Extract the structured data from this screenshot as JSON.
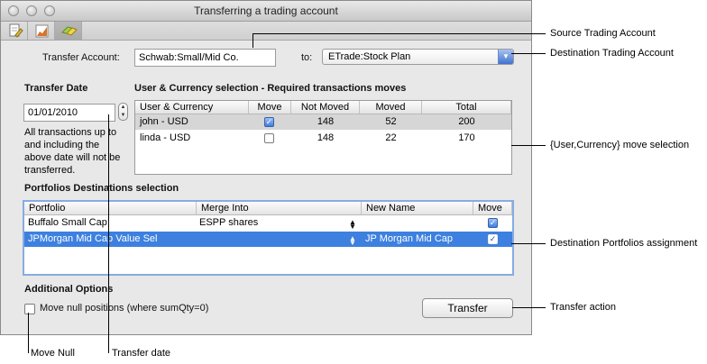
{
  "window": {
    "title": "Transferring a trading account"
  },
  "toolbar": {
    "icons": [
      "note-icon",
      "chart-icon",
      "transfer-icon"
    ]
  },
  "transfer": {
    "account_label": "Transfer Account:",
    "account_value": "Schwab:Small/Mid Co.",
    "to_label": "to:",
    "destination_value": "ETrade:Stock Plan"
  },
  "transfer_date": {
    "heading": "Transfer Date",
    "value": "01/01/2010",
    "note_lines": [
      "All transactions up to",
      "and including the",
      "above date will not be",
      "transferred."
    ]
  },
  "user_currency": {
    "heading": "User & Currency selection - Required transactions moves",
    "columns": [
      "User & Currency",
      "Move",
      "Not Moved",
      "Moved",
      "Total"
    ],
    "rows": [
      {
        "name": "john - USD",
        "move": true,
        "not_moved": "148",
        "moved": "52",
        "total": "200",
        "selected": true
      },
      {
        "name": "linda - USD",
        "move": false,
        "not_moved": "148",
        "moved": "22",
        "total": "170",
        "selected": false
      }
    ]
  },
  "portfolios": {
    "heading": "Portfolios Destinations selection",
    "columns": [
      "Portfolio",
      "Merge Into",
      "New Name",
      "Move"
    ],
    "rows": [
      {
        "portfolio": "Buffalo Small Cap",
        "merge_into": "ESPP shares",
        "new_name": "",
        "move": true,
        "selected": false
      },
      {
        "portfolio": "JPMorgan Mid Cap Value Sel",
        "merge_into": "",
        "new_name": "JP Morgan Mid Cap",
        "move": true,
        "selected": true
      }
    ]
  },
  "options": {
    "heading": "Additional Options",
    "null_label": "Move null positions (where sumQty=0)",
    "null_checked": false,
    "transfer_button": "Transfer"
  },
  "annotations": {
    "source": "Source Trading Account",
    "destination": "Destination Trading Account",
    "user_currency": "{User,Currency} move selection",
    "portfolios": "Destination Portfolios assignment",
    "transfer_action": "Transfer action",
    "move_null": "Move Null",
    "transfer_date": "Transfer date"
  },
  "colors": {
    "selection": "#3d80df",
    "row_highlight": "#d6d6d6"
  }
}
